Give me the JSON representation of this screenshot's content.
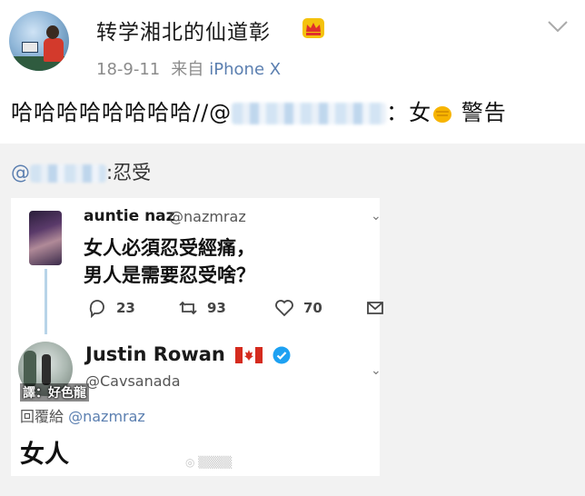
{
  "post": {
    "username": "转学湘北的仙道彰",
    "date": "18-9-11",
    "from_label": "来自",
    "device": "iPhone X",
    "text_prefix": "哈哈哈哈哈哈哈哈//@",
    "text_suffix": "：女",
    "text_tail": "警告"
  },
  "repost": {
    "mention": "@",
    "text": ":忍受"
  },
  "tweet1": {
    "name": "auntie naz",
    "handle": "@nazmraz",
    "text_line1": "女人必須忍受經痛，",
    "text_line2": "男人是需要忍受啥？",
    "replies": "23",
    "retweets": "93",
    "likes": "70"
  },
  "tweet2": {
    "name": "Justin Rowan",
    "handle": "@Cavsanada",
    "reply_label": "回覆給",
    "reply_to": "@nazmraz",
    "text": "女人",
    "avatar_badge": "譯：好色龍"
  },
  "colors": {
    "link": "#5b7fb0",
    "meta": "#8b8b8b",
    "repost_bg": "#f2f2f2",
    "verified": "#1da1f2",
    "canada_red": "#d52b1e"
  },
  "icons": [
    "crown-icon",
    "chevron-down-icon",
    "fist-emoji-icon",
    "reply-icon",
    "retweet-icon",
    "like-icon",
    "share-icon",
    "verified-icon",
    "canada-flag-icon"
  ]
}
